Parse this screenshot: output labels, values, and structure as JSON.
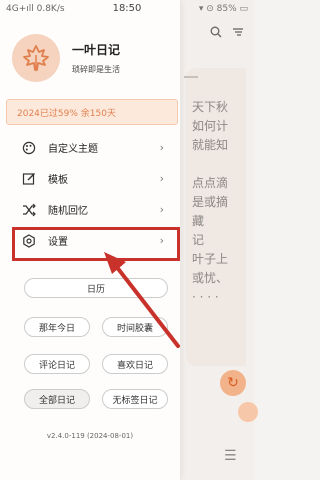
{
  "status_bar": {
    "left": "4G+ıll 0.8K/s",
    "time": "18:50",
    "right": "▾ ⊙ 85% ▭"
  },
  "drawer": {
    "app_name": "一叶日记",
    "slogan": "琐碎即是生活",
    "stats": "2024已过59% 余150天",
    "menu": [
      {
        "label": "自定义主题",
        "icon": "palette-icon"
      },
      {
        "label": "模板",
        "icon": "edit-icon"
      },
      {
        "label": "随机回忆",
        "icon": "shuffle-icon"
      },
      {
        "label": "设置",
        "icon": "settings-icon"
      }
    ],
    "calendar_btn": "日历",
    "buttons": [
      "那年今日",
      "时间胶囊",
      "评论日记",
      "喜欢日记",
      "全部日记",
      "无标签日记"
    ],
    "version": "v2.4.0-119 (2024-08-01)"
  },
  "background": {
    "lines": [
      "天下秋",
      "如何计",
      "就能知",
      "",
      "点点滴",
      "是或摘",
      "藏",
      "记",
      "叶子上",
      "或忧、",
      "· · · ·"
    ]
  },
  "colors": {
    "accent": "#e07f4d",
    "highlight_box": "#c8322b",
    "stats_bg": "#fde9dc"
  }
}
